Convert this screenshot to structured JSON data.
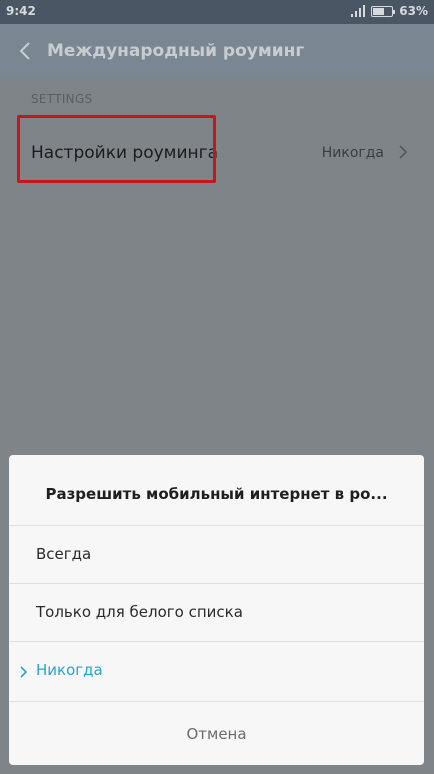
{
  "status_bar": {
    "time": "9:42",
    "battery_percent": "63%",
    "battery_level": 0.63,
    "icons": [
      "signal-icon",
      "battery-icon"
    ]
  },
  "header": {
    "title": "Международный роуминг",
    "back_icon": "chevron-left-icon"
  },
  "settings": {
    "section_label": "SETTINGS",
    "roaming_row": {
      "title": "Настройки роуминга",
      "value": "Никогда",
      "icon": "chevron-right-icon"
    }
  },
  "dialog": {
    "title": "Разрешить мобильный интернет в ро...",
    "options": [
      {
        "label": "Всегда",
        "selected": false
      },
      {
        "label": "Только для белого списка",
        "selected": false
      },
      {
        "label": "Никогда",
        "selected": true
      }
    ],
    "cancel_label": "Отмена"
  },
  "colors": {
    "accent": "#2aa3cc",
    "highlight": "#c4161c",
    "header": "#7a8691",
    "status_bar": "#4a5663"
  }
}
